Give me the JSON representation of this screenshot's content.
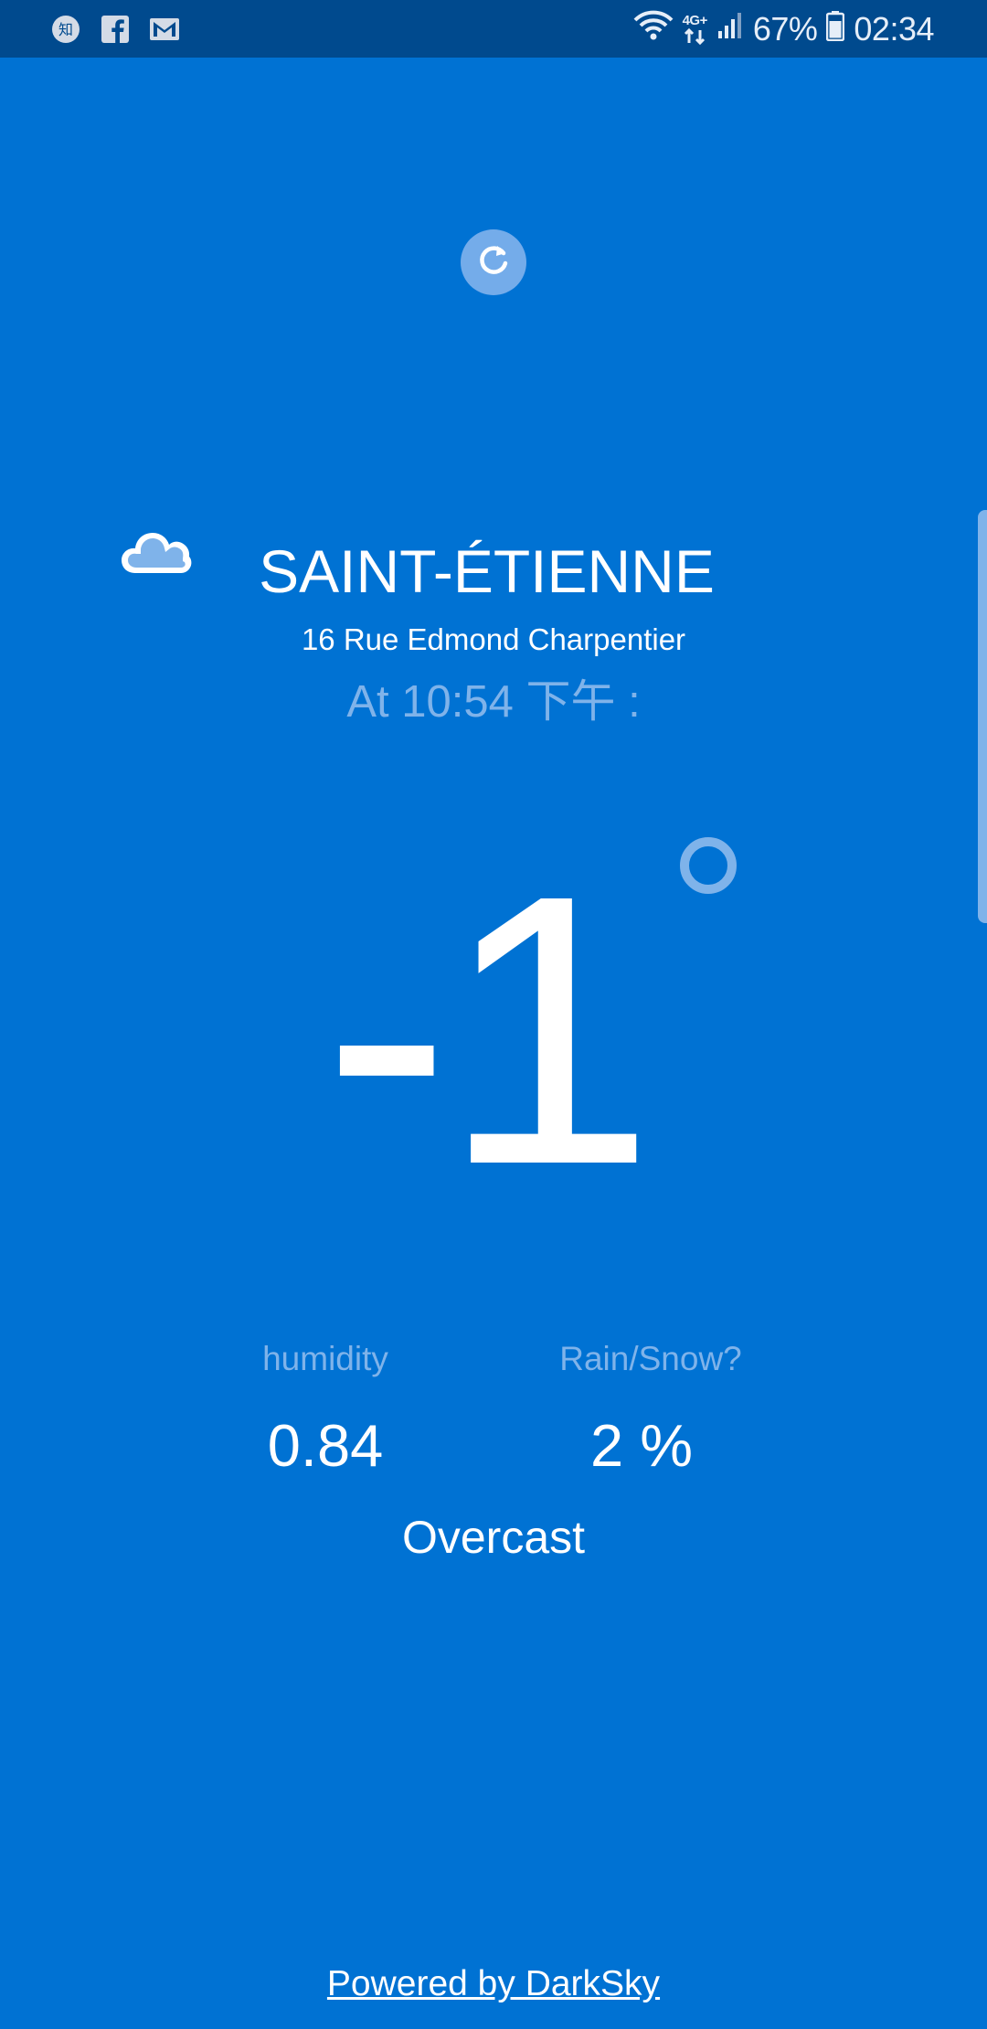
{
  "status_bar": {
    "notification_icons": [
      "zhihu-icon",
      "facebook-icon",
      "gmail-icon"
    ],
    "zhihu_glyph": "知",
    "network_label": "4G+",
    "battery_percent": "67%",
    "clock": "02:34"
  },
  "weather": {
    "icon": "cloud-icon",
    "city": "SAINT-ÉTIENNE",
    "address": "16 Rue Edmond Charpentier",
    "time_label": "At 10:54 下午 :",
    "temperature": "-1",
    "humidity_label": "humidity",
    "humidity_value": "0.84",
    "precip_label": "Rain/Snow?",
    "precip_value": "2 %",
    "summary": "Overcast"
  },
  "footer": {
    "powered_by": "Powered by DarkSky"
  },
  "colors": {
    "background": "#0072d3",
    "status_bar": "#004a8e",
    "accent_light": "#7fb3ea",
    "text": "#ffffff"
  }
}
